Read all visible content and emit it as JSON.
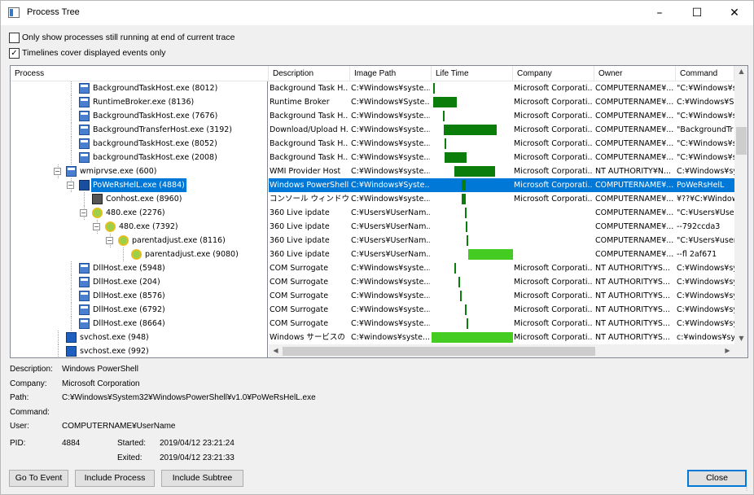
{
  "window": {
    "title": "Process Tree"
  },
  "options": {
    "only_running": {
      "label": "Only show processes still running at end of current trace",
      "checked": false
    },
    "timelines_cover": {
      "label": "Timelines cover displayed events only",
      "checked": true
    }
  },
  "columns": [
    "Process",
    "Description",
    "Image Path",
    "Life Time",
    "Company",
    "Owner",
    "Command"
  ],
  "rows": [
    {
      "name": "BackgroundTaskHost.exe (8012)",
      "depth": 4,
      "icon": "proc",
      "exp": "",
      "desc": "Background Task H...",
      "path": "C:¥Windows¥syste...",
      "company": "Microsoft Corporati...",
      "owner": "COMPUTERNAME¥...",
      "cmd": "\"C:¥Windows¥sys",
      "bar": [
        0.02,
        0.01
      ],
      "bc": "#0a7d0a"
    },
    {
      "name": "RuntimeBroker.exe (8136)",
      "depth": 4,
      "icon": "proc",
      "exp": "",
      "desc": "Runtime Broker",
      "path": "C:¥Windows¥Syste...",
      "company": "Microsoft Corporati...",
      "owner": "COMPUTERNAME¥...",
      "cmd": "C:¥Windows¥Sy",
      "bar": [
        0.02,
        0.29
      ],
      "bc": "#0a7d0a"
    },
    {
      "name": "BackgroundTaskHost.exe (7676)",
      "depth": 4,
      "icon": "proc",
      "exp": "",
      "desc": "Background Task H...",
      "path": "C:¥Windows¥syste...",
      "company": "Microsoft Corporati...",
      "owner": "COMPUTERNAME¥...",
      "cmd": "\"C:¥Windows¥sys",
      "bar": [
        0.14,
        0.01
      ],
      "bc": "#0a7d0a"
    },
    {
      "name": "BackgroundTransferHost.exe (3192)",
      "depth": 4,
      "icon": "proc",
      "exp": "",
      "desc": "Download/Upload H...",
      "path": "C:¥Windows¥syste...",
      "company": "Microsoft Corporati...",
      "owner": "COMPUTERNAME¥...",
      "cmd": "\"BackgroundTr",
      "bar": [
        0.15,
        0.65
      ],
      "bc": "#0a7d0a"
    },
    {
      "name": "backgroundTaskHost.exe (8052)",
      "depth": 4,
      "icon": "proc",
      "exp": "",
      "desc": "Background Task H...",
      "path": "C:¥Windows¥syste...",
      "company": "Microsoft Corporati...",
      "owner": "COMPUTERNAME¥...",
      "cmd": "\"C:¥Windows¥sys",
      "bar": [
        0.16,
        0.01
      ],
      "bc": "#0a7d0a"
    },
    {
      "name": "backgroundTaskHost.exe (2008)",
      "depth": 4,
      "icon": "proc",
      "exp": "",
      "desc": "Background Task H...",
      "path": "C:¥Windows¥syste...",
      "company": "Microsoft Corporati...",
      "owner": "COMPUTERNAME¥...",
      "cmd": "\"C:¥Windows¥sys",
      "bar": [
        0.16,
        0.27
      ],
      "bc": "#0a7d0a"
    },
    {
      "name": "wmiprvse.exe (600)",
      "depth": 3,
      "icon": "proc",
      "exp": "−",
      "desc": "WMI Provider Host",
      "path": "C:¥Windows¥syste...",
      "company": "Microsoft Corporati...",
      "owner": "NT AUTHORITY¥N...",
      "cmd": "C:¥Windows¥sy",
      "bar": [
        0.28,
        0.5
      ],
      "bc": "#0a7d0a"
    },
    {
      "name": "PoWeRsHelL.exe (4884)",
      "depth": 4,
      "icon": "ps",
      "exp": "−",
      "sel": true,
      "desc": "Windows PowerShell",
      "path": "C:¥Windows¥Syste...",
      "company": "Microsoft Corporati...",
      "owner": "COMPUTERNAME¥...",
      "cmd": "PoWeRsHelL",
      "bar": [
        0.37,
        0.05
      ],
      "bc": "#0a7d0a"
    },
    {
      "name": "Conhost.exe (8960)",
      "depth": 5,
      "icon": "con",
      "exp": "",
      "desc": "コンソール ウィンドウ ...",
      "path": "C:¥Windows¥syste...",
      "company": "Microsoft Corporati...",
      "owner": "COMPUTERNAME¥...",
      "cmd": "¥??¥C:¥Window",
      "bar": [
        0.37,
        0.05
      ],
      "bc": "#0a7d0a"
    },
    {
      "name": "480.exe (2276)",
      "depth": 5,
      "icon": "360",
      "exp": "−",
      "desc": "360 Live ipdate",
      "path": "C:¥Users¥UserNam...",
      "company": "",
      "owner": "COMPUTERNAME¥...",
      "cmd": "\"C:¥Users¥User",
      "bar": [
        0.41,
        0.01
      ],
      "bc": "#0a7d0a"
    },
    {
      "name": "480.exe (7392)",
      "depth": 6,
      "icon": "360",
      "exp": "−",
      "desc": "360 Live ipdate",
      "path": "C:¥Users¥UserNam...",
      "company": "",
      "owner": "COMPUTERNAME¥...",
      "cmd": "--792ccda3",
      "bar": [
        0.42,
        0.01
      ],
      "bc": "#0a7d0a"
    },
    {
      "name": "parentadjust.exe (8116)",
      "depth": 7,
      "icon": "360",
      "exp": "−",
      "desc": "360 Live ipdate",
      "path": "C:¥Users¥UserNam...",
      "company": "",
      "owner": "COMPUTERNAME¥...",
      "cmd": "\"C:¥Users¥user",
      "bar": [
        0.43,
        0.01
      ],
      "bc": "#0a7d0a"
    },
    {
      "name": "parentadjust.exe (9080)",
      "depth": 8,
      "icon": "360",
      "exp": "",
      "desc": "360 Live ipdate",
      "path": "C:¥Users¥UserNam...",
      "company": "",
      "owner": "COMPUTERNAME¥...",
      "cmd": "--fl 2af671",
      "bar": [
        0.45,
        0.55
      ],
      "bc": "#44cc22"
    },
    {
      "name": "DllHost.exe (5948)",
      "depth": 4,
      "icon": "proc",
      "exp": "",
      "desc": "COM Surrogate",
      "path": "C:¥Windows¥syste...",
      "company": "Microsoft Corporati...",
      "owner": "NT AUTHORITY¥S...",
      "cmd": "C:¥Windows¥sys",
      "bar": [
        0.28,
        0.02
      ],
      "bc": "#0a7d0a"
    },
    {
      "name": "DllHost.exe (204)",
      "depth": 4,
      "icon": "proc",
      "exp": "",
      "desc": "COM Surrogate",
      "path": "C:¥Windows¥syste...",
      "company": "Microsoft Corporati...",
      "owner": "NT AUTHORITY¥S...",
      "cmd": "C:¥Windows¥sys",
      "bar": [
        0.33,
        0.02
      ],
      "bc": "#0a7d0a"
    },
    {
      "name": "DllHost.exe (8576)",
      "depth": 4,
      "icon": "proc",
      "exp": "",
      "desc": "COM Surrogate",
      "path": "C:¥Windows¥syste...",
      "company": "Microsoft Corporati...",
      "owner": "NT AUTHORITY¥S...",
      "cmd": "C:¥Windows¥sys",
      "bar": [
        0.35,
        0.02
      ],
      "bc": "#0a7d0a"
    },
    {
      "name": "DllHost.exe (6792)",
      "depth": 4,
      "icon": "proc",
      "exp": "",
      "desc": "COM Surrogate",
      "path": "C:¥Windows¥syste...",
      "company": "Microsoft Corporati...",
      "owner": "NT AUTHORITY¥S...",
      "cmd": "C:¥Windows¥sys",
      "bar": [
        0.41,
        0.02
      ],
      "bc": "#0a7d0a"
    },
    {
      "name": "DllHost.exe (8664)",
      "depth": 4,
      "icon": "proc",
      "exp": "",
      "desc": "COM Surrogate",
      "path": "C:¥Windows¥syste...",
      "company": "Microsoft Corporati...",
      "owner": "NT AUTHORITY¥S...",
      "cmd": "C:¥Windows¥sys",
      "bar": [
        0.43,
        0.02
      ],
      "bc": "#0a7d0a"
    },
    {
      "name": "svchost.exe (948)",
      "depth": 3,
      "icon": "svc",
      "exp": "",
      "desc": "Windows サービスの ...",
      "path": "C:¥windows¥syste...",
      "company": "Microsoft Corporati...",
      "owner": "NT AUTHORITY¥S...",
      "cmd": "c:¥windows¥sys",
      "bar": [
        0.0,
        1.0
      ],
      "bc": "#44cc22"
    },
    {
      "name": "svchost.exe (992)",
      "depth": 3,
      "icon": "svc",
      "exp": "",
      "desc": "",
      "path": "",
      "company": "",
      "owner": "",
      "cmd": "",
      "bar": null,
      "bc": ""
    }
  ],
  "details": {
    "description_label": "Description:",
    "description": "Windows PowerShell",
    "company_label": "Company:",
    "company": "Microsoft Corporation",
    "path_label": "Path:",
    "path": "C:¥Windows¥System32¥WindowsPowerShell¥v1.0¥PoWeRsHelL.exe",
    "command_label": "Command:",
    "command": "",
    "user_label": "User:",
    "user": "COMPUTERNAME¥UserName",
    "pid_label": "PID:",
    "pid": "4884",
    "started_label": "Started:",
    "started": "2019/04/12 23:21:24",
    "exited_label": "Exited:",
    "exited": "2019/04/12 23:21:33"
  },
  "buttons": {
    "go_to_event": "Go To Event",
    "include_process": "Include Process",
    "include_subtree": "Include Subtree",
    "close": "Close"
  },
  "icons": {
    "minimize": "minimize-icon",
    "maximize": "maximize-icon",
    "close": "close-icon"
  }
}
